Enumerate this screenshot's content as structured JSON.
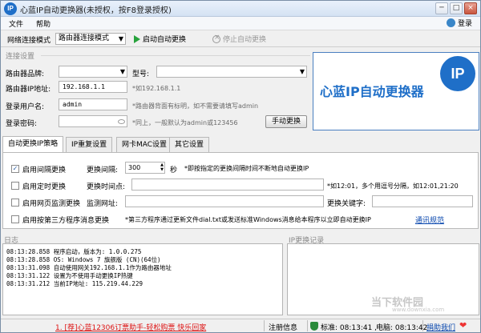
{
  "window": {
    "title": "心蓝IP自动更换器(未授权，按F8登录授权)",
    "app_icon_text": "IP",
    "min_label": "─",
    "max_label": "□",
    "close_label": "×"
  },
  "menu": {
    "file": "文件",
    "help": "帮助",
    "login": "登录"
  },
  "toolbar": {
    "mode_label": "网络连接模式",
    "mode_value": "路由器连接模式",
    "start_label": "启动自动更换",
    "stop_label": "停止自动更换"
  },
  "connection": {
    "group_title": "连接设置",
    "brand_label": "路由器品牌:",
    "model_label": "型号:",
    "ip_label": "路由器IP地址:",
    "ip_value": "192.168.1.1",
    "ip_hint": "*如192.168.1.1",
    "user_label": "登录用户名:",
    "user_value": "admin",
    "user_hint": "*路由器背面有标明，如不需要请填写admin",
    "pass_label": "登录密码:",
    "pass_hint": "*同上，一般默认为admin或123456",
    "manual_button": "手动更换"
  },
  "brand_panel": {
    "title": "心蓝IP自动更换器",
    "logo_text": "IP"
  },
  "tabs": [
    {
      "label": "自动更换IP策略"
    },
    {
      "label": "IP重复设置"
    },
    {
      "label": "网卡MAC设置"
    },
    {
      "label": "其它设置"
    }
  ],
  "strategy": {
    "interval_check": "启用间隔更换",
    "interval_checked": true,
    "interval_label": "更换间隔:",
    "interval_value": "300",
    "interval_unit": "秒",
    "interval_hint": "*即按指定的更换间隔时间不断地自动更换IP",
    "timed_check": "启用定时更换",
    "timed_checked": false,
    "timed_label": "更换时间点:",
    "timed_hint": "*如12:01，多个用逗号分隔，如12:01,21:20",
    "web_check": "启用网页监测更换",
    "web_checked": false,
    "web_label": "监测网址:",
    "keyword_label": "更换关键字:",
    "third_check": "启用按第三方程序消息更换",
    "third_checked": false,
    "third_hint": "*第三方程序通过更新文件dial.txt或发送标准Windows消息给本程序以立即自动更换IP",
    "third_link": "通讯规范"
  },
  "log": {
    "title": "日志",
    "lines": [
      "08:13:28.858  程序启动，版本为: 1.0.0.275",
      "08:13:28.858  OS: Windows 7 旗舰版 (CN)(64位)",
      "08:13:31.098  自动使用网关192.168.1.1作为路由器地址",
      "08:13:31.122  设置为不使用手动更换IP热键",
      "08:13:31.212  当前IP地址: 115.219.44.229"
    ]
  },
  "history": {
    "title": "IP更换记录"
  },
  "status": {
    "promo_link": "1. [荐]心蓝12306订票助手-轻松购票 快乐回家",
    "register": "注册信息",
    "standard_time": "标准: 08:13:41 ,",
    "pc_time": "电脑: 08:13:42",
    "donate": "捐助我们"
  },
  "watermark": {
    "text": "当下软件园",
    "sub": "www.downxia.com"
  }
}
